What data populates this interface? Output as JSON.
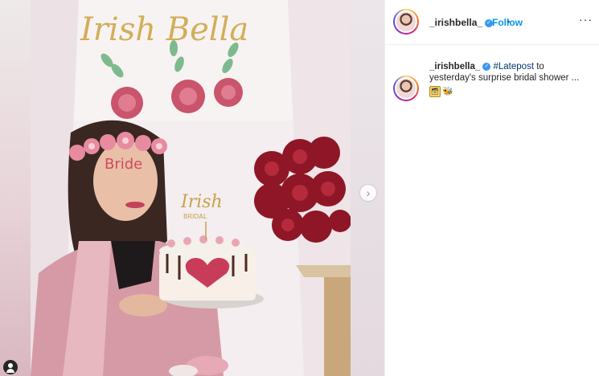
{
  "post": {
    "username": "_irishbella_",
    "follow_label": "Follow",
    "more_label": "···",
    "separator": "•",
    "verified_mark": "✓",
    "caption_username": "_irishbella_",
    "caption_hashtag": "#Latepost",
    "caption_text": " to yesterday's surprise bridal shower ...",
    "emoji_1": "🗃",
    "emoji_2": "🐝"
  },
  "photo": {
    "banner_text": "Irish Bella",
    "topper_text": "Irish",
    "topper_sub": "BRIDAL",
    "cheek_text": "Bride"
  },
  "icons": {
    "next": "chevron-right-icon",
    "user_tag": "user-tag-icon",
    "verified": "verified-badge-icon"
  },
  "colors": {
    "follow": "#0095f6",
    "verified": "#3897f0",
    "hashtag": "#00376b"
  }
}
